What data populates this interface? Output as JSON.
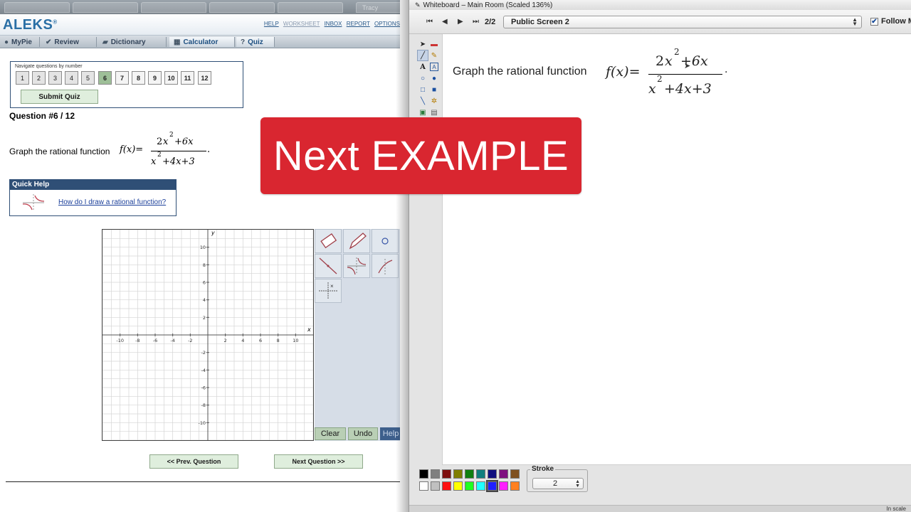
{
  "browser": {
    "tabs": [
      "",
      "",
      "",
      "",
      "",
      "Tracy"
    ]
  },
  "aleks": {
    "logo": "ALEKS",
    "logo_mark": "®",
    "top_links": [
      "HELP",
      "WORKSHEET",
      "INBOX",
      "REPORT",
      "OPTIONS"
    ],
    "nav": [
      {
        "label": "MyPie",
        "icon": "pie-icon"
      },
      {
        "label": "Review",
        "icon": "check-icon"
      },
      {
        "label": "Dictionary",
        "icon": "book-icon"
      },
      {
        "label": "Calculator",
        "icon": "calculator-icon"
      },
      {
        "label": "Quiz",
        "icon": "quiz-icon"
      }
    ],
    "quiz_nav": {
      "label": "Navigate questions by number",
      "numbers": [
        "1",
        "2",
        "3",
        "4",
        "5",
        "6",
        "7",
        "8",
        "9",
        "10",
        "11",
        "12"
      ],
      "current": "6",
      "submit_label": "Submit Quiz"
    },
    "question_title": "Question #6 / 12",
    "question": {
      "prompt": "Graph the rational function",
      "func": "f(x)=",
      "num_coeff": "2",
      "num_var": "x",
      "num_exp": "2",
      "num_rest": "+6x",
      "den_var": "x",
      "den_exp": "2",
      "den_rest": "+4x+3",
      "end": "."
    },
    "quick_help": {
      "title": "Quick Help",
      "link": "How do I draw a rational function?"
    },
    "graph": {
      "x_label": "x",
      "y_label": "y",
      "x_ticks": [
        "-10",
        "-8",
        "-6",
        "-4",
        "-2",
        "2",
        "4",
        "6",
        "8",
        "10"
      ],
      "y_ticks": [
        "10",
        "8",
        "6",
        "4",
        "2",
        "-2",
        "-4",
        "-6",
        "-8",
        "-10"
      ]
    },
    "tools": {
      "clear": "Clear",
      "undo": "Undo",
      "help": "Help"
    },
    "prev_question": "<< Prev. Question",
    "next_question": "Next Question >>"
  },
  "whiteboard": {
    "title": "Whiteboard – Main Room (Scaled 136%)",
    "page": "2/2",
    "screen": "Public Screen 2",
    "follow_label": "Follow M",
    "text": "Graph the rational function",
    "func": "f(x)=",
    "num_coeff": "2",
    "num_var": "x",
    "num_exp": "2",
    "num_rest": "+6x",
    "den_var": "x",
    "den_exp": "2",
    "den_rest": "+4x+3",
    "end": ".",
    "stroke_label": "Stroke",
    "stroke_value": "2",
    "status_right": "In scale",
    "palette": [
      "#000000",
      "#7f7f7f",
      "#7f1010",
      "#7f7f00",
      "#107f10",
      "#107f7f",
      "#10107f",
      "#7f107f",
      "#7f5020",
      "#ffffff",
      "#c0c0c0",
      "#ff1010",
      "#ffff00",
      "#20ff20",
      "#20ffff",
      "#2020ff",
      "#ff20ff",
      "#ff8020"
    ],
    "palette_selected": 15
  },
  "banner": {
    "text": "Next EXAMPLE",
    "color": "#d92630"
  }
}
